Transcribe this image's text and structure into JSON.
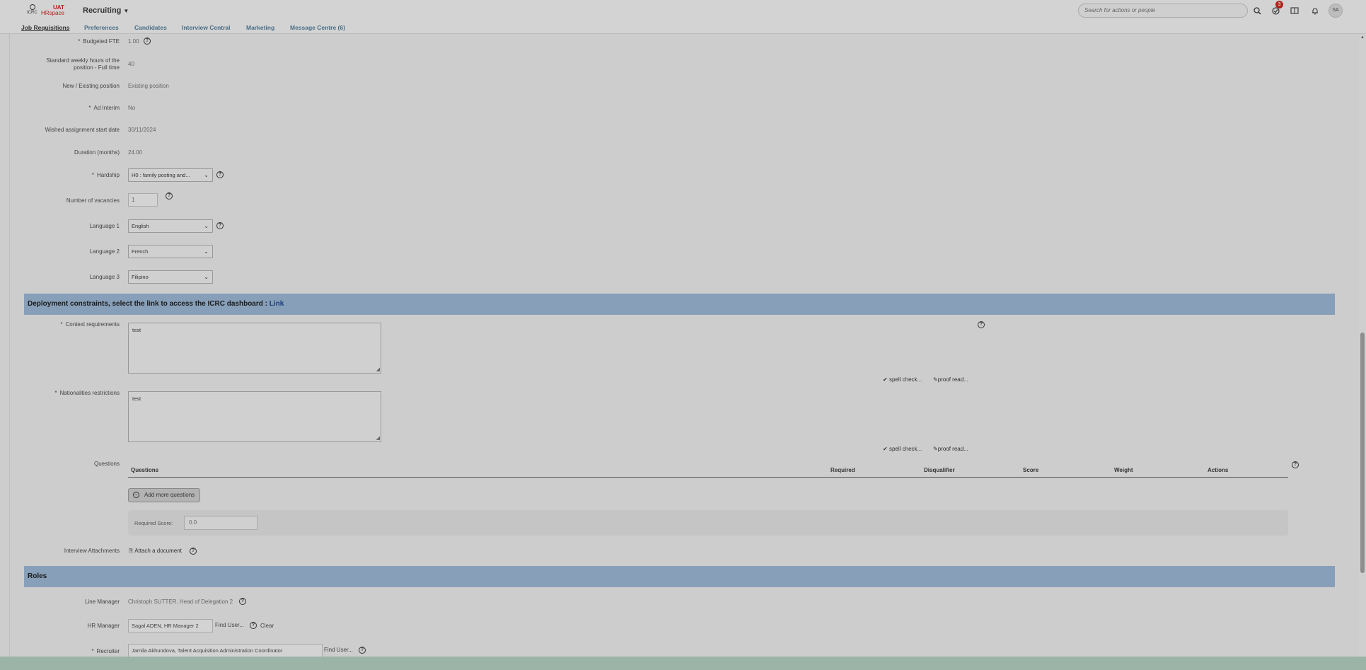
{
  "header": {
    "logo_icrc": "ICRC",
    "logo_env": "UAT",
    "logo_brand": "HRspace",
    "app_title": "Recruiting",
    "search_placeholder": "Search for actions or people",
    "todo_count": "3",
    "avatar_initials": "SA"
  },
  "nav": {
    "items": [
      "Job Requisitions",
      "Preferences",
      "Candidates",
      "Interview Central",
      "Marketing",
      "Message Centre (6)"
    ]
  },
  "fields": {
    "budgeted_fte": {
      "label": "Budgeted FTE",
      "value": "1.00"
    },
    "weekly_hours": {
      "label_1": "Standard weekly hours of the",
      "label_2": "position - Full time",
      "value": "40"
    },
    "new_existing": {
      "label": "New / Existing position",
      "value": "Existing position"
    },
    "ad_interim": {
      "label": "Ad Interim",
      "value": "No"
    },
    "start_date": {
      "label": "Wished assignment start date",
      "value": "30/11/2024"
    },
    "duration": {
      "label": "Duration (months)",
      "value": "24.00"
    },
    "hardship": {
      "label": "Hardship",
      "value": "H0 : family posting and..."
    },
    "vacancies": {
      "label": "Number of vacancies",
      "value": "1"
    },
    "language1": {
      "label": "Language 1",
      "value": "English"
    },
    "language2": {
      "label": "Language 2",
      "value": "French"
    },
    "language3": {
      "label": "Language 3",
      "value": "Filipino"
    }
  },
  "deployment": {
    "title": "Deployment constraints, select the link to access the ICRC dashboard : ",
    "link": "Link",
    "context_label": "Context requirements",
    "context_value": "test",
    "nationalities_label": "Nationalities restrictions",
    "nationalities_value": "test",
    "spell_check": "spell check...",
    "proof_read": "proof read..."
  },
  "questions": {
    "label": "Questions",
    "columns": [
      "Questions",
      "Required",
      "Disqualifier",
      "Score",
      "Weight",
      "Actions"
    ],
    "add_button": "Add more questions",
    "required_score_label": "Required Score:",
    "required_score_value": "0.0"
  },
  "interview": {
    "label": "Interview Attachments",
    "attach": "Attach a document"
  },
  "roles": {
    "title": "Roles",
    "line_manager_label": "Line Manager",
    "line_manager_value": "Christoph SUTTER, Head of Delegation 2",
    "hr_manager_label": "HR Manager",
    "hr_manager_value": "Sagal ADEN, HR Manager 2",
    "recruiter_label": "Recruiter",
    "recruiter_value": "Jamila Akhundova, Talent Acquisition Administration Coordinator",
    "find_user": "Find User...",
    "clear": "Clear"
  },
  "icons": {
    "help": "?",
    "dropdown": "chevron-down",
    "search": "search-icon",
    "todo": "checkmark-circle-icon",
    "docs": "book-icon",
    "notifications": "bell-icon"
  }
}
